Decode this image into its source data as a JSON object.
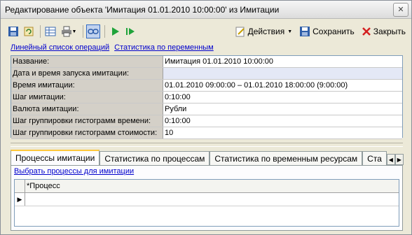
{
  "window": {
    "title": "Редактирование объекта 'Имитация 01.01.2010 10:00:00' из Имитации"
  },
  "toolbar": {
    "actions_label": "Действия",
    "save_label": "Сохранить",
    "close_label": "Закрыть"
  },
  "links": {
    "op_list": "Линейный список операций",
    "var_stats": "Статистика по переменным"
  },
  "props": [
    {
      "name": "Название:",
      "value": "Имитация 01.01.2010 10:00:00"
    },
    {
      "name": "Дата и время запуска имитации:",
      "value": ""
    },
    {
      "name": "Время имитации:",
      "value": "01.01.2010 09:00:00 – 01.01.2010 18:00:00 (9:00:00)"
    },
    {
      "name": "Шаг имитации:",
      "value": "0:10:00"
    },
    {
      "name": "Валюта имитации:",
      "value": "Рубли"
    },
    {
      "name": "Шаг группировки гистограмм времени:",
      "value": "0:10:00"
    },
    {
      "name": "Шаг группировки гистограмм стоимости:",
      "value": "10"
    }
  ],
  "tabs": [
    "Процессы имитации",
    "Статистика по процессам",
    "Статистика по временным ресурсам",
    "Ста"
  ],
  "panel": {
    "link": "Выбрать процессы для имитации",
    "column": "*Процесс",
    "row_marker": "▶"
  }
}
